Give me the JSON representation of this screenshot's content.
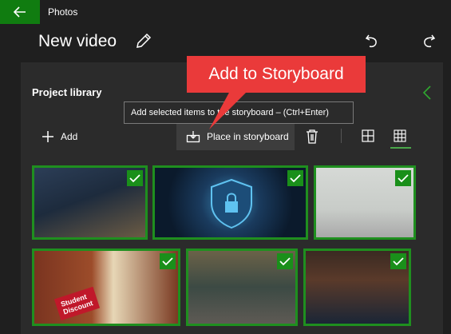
{
  "app": {
    "title": "Photos"
  },
  "header": {
    "video_title": "New video"
  },
  "library": {
    "title": "Project library",
    "add_label": "Add",
    "place_label": "Place in storyboard",
    "tooltip": "Add selected items to the storyboard – (Ctrl+Enter)"
  },
  "callout": {
    "text": "Add to Storyboard"
  },
  "thumbnails": [
    {
      "selected": true,
      "sticker_line1": "",
      "sticker_line2": ""
    },
    {
      "selected": true,
      "sticker_line1": "",
      "sticker_line2": ""
    },
    {
      "selected": true,
      "sticker_line1": "",
      "sticker_line2": ""
    },
    {
      "selected": true,
      "sticker_line1": "Student",
      "sticker_line2": "Discount"
    },
    {
      "selected": true,
      "sticker_line1": "",
      "sticker_line2": ""
    },
    {
      "selected": true,
      "sticker_line1": "",
      "sticker_line2": ""
    }
  ],
  "colors": {
    "accent": "#107c10",
    "callout": "#ea3a3a",
    "selection_border": "#1f8f1f",
    "background": "#1f1f1f",
    "panel": "#2b2b2b"
  },
  "icons": {
    "back": "arrow-left-icon",
    "edit": "pencil-icon",
    "undo": "undo-icon",
    "redo": "redo-icon",
    "collapse": "chevron-left-icon",
    "add": "plus-icon",
    "place": "place-in-storyboard-icon",
    "delete": "trash-icon",
    "view_list": "large-grid-icon",
    "view_grid": "small-grid-icon",
    "check": "checkmark-icon"
  }
}
